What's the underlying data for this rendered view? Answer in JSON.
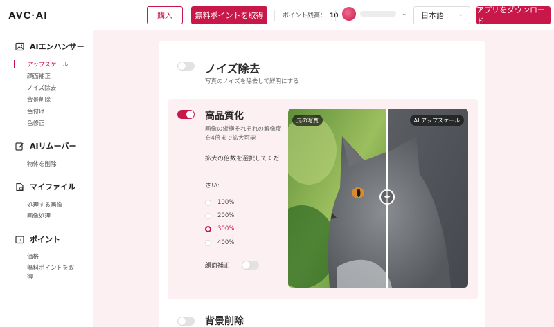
{
  "header": {
    "logo": "AVC·AI",
    "buy_label": "購入",
    "free_points_label": "無料ポイントを取得",
    "points_label": "ポイント残高：",
    "points_value": "10",
    "language": "日本語",
    "download_label": "アプリをダウンロード"
  },
  "sidebar": {
    "sections": [
      {
        "title": "AIエンハンサー",
        "icon": "image-icon",
        "items": [
          "アップスケール",
          "顔面補正",
          "ノイズ除去",
          "背景削除",
          "色付け",
          "色修正"
        ]
      },
      {
        "title": "AIリムーバー",
        "icon": "edit-icon",
        "items": [
          "物体を削除"
        ]
      },
      {
        "title": "マイファイル",
        "icon": "file-icon",
        "items": [
          "処理する画像",
          "画像処理"
        ]
      },
      {
        "title": "ポイント",
        "icon": "wallet-icon",
        "items": [
          "価格",
          "無料ポイントを取",
          "得"
        ]
      }
    ]
  },
  "main": {
    "noise": {
      "title": "ノイズ除去",
      "desc": "写真のノイズを除去して鮮明にする",
      "enabled": false
    },
    "hq": {
      "title": "高品質化",
      "desc": "画像の縦横それぞれの解像度を4倍まで拡大可能",
      "pick_label_a": "拡大の倍数を選択してくだ",
      "pick_label_b": "さい:",
      "options": [
        "100%",
        "200%",
        "300%",
        "400%"
      ],
      "selected": "300%",
      "face_label": "顔面補正:",
      "face_enabled": false,
      "enabled": true
    },
    "compare": {
      "left_tag": "元の写真",
      "right_tag": "AI アップスケール"
    },
    "bg": {
      "title": "背景削除",
      "enabled": false
    }
  },
  "colors": {
    "accent": "#c8184a",
    "bg_tint": "#fdf0f3"
  }
}
